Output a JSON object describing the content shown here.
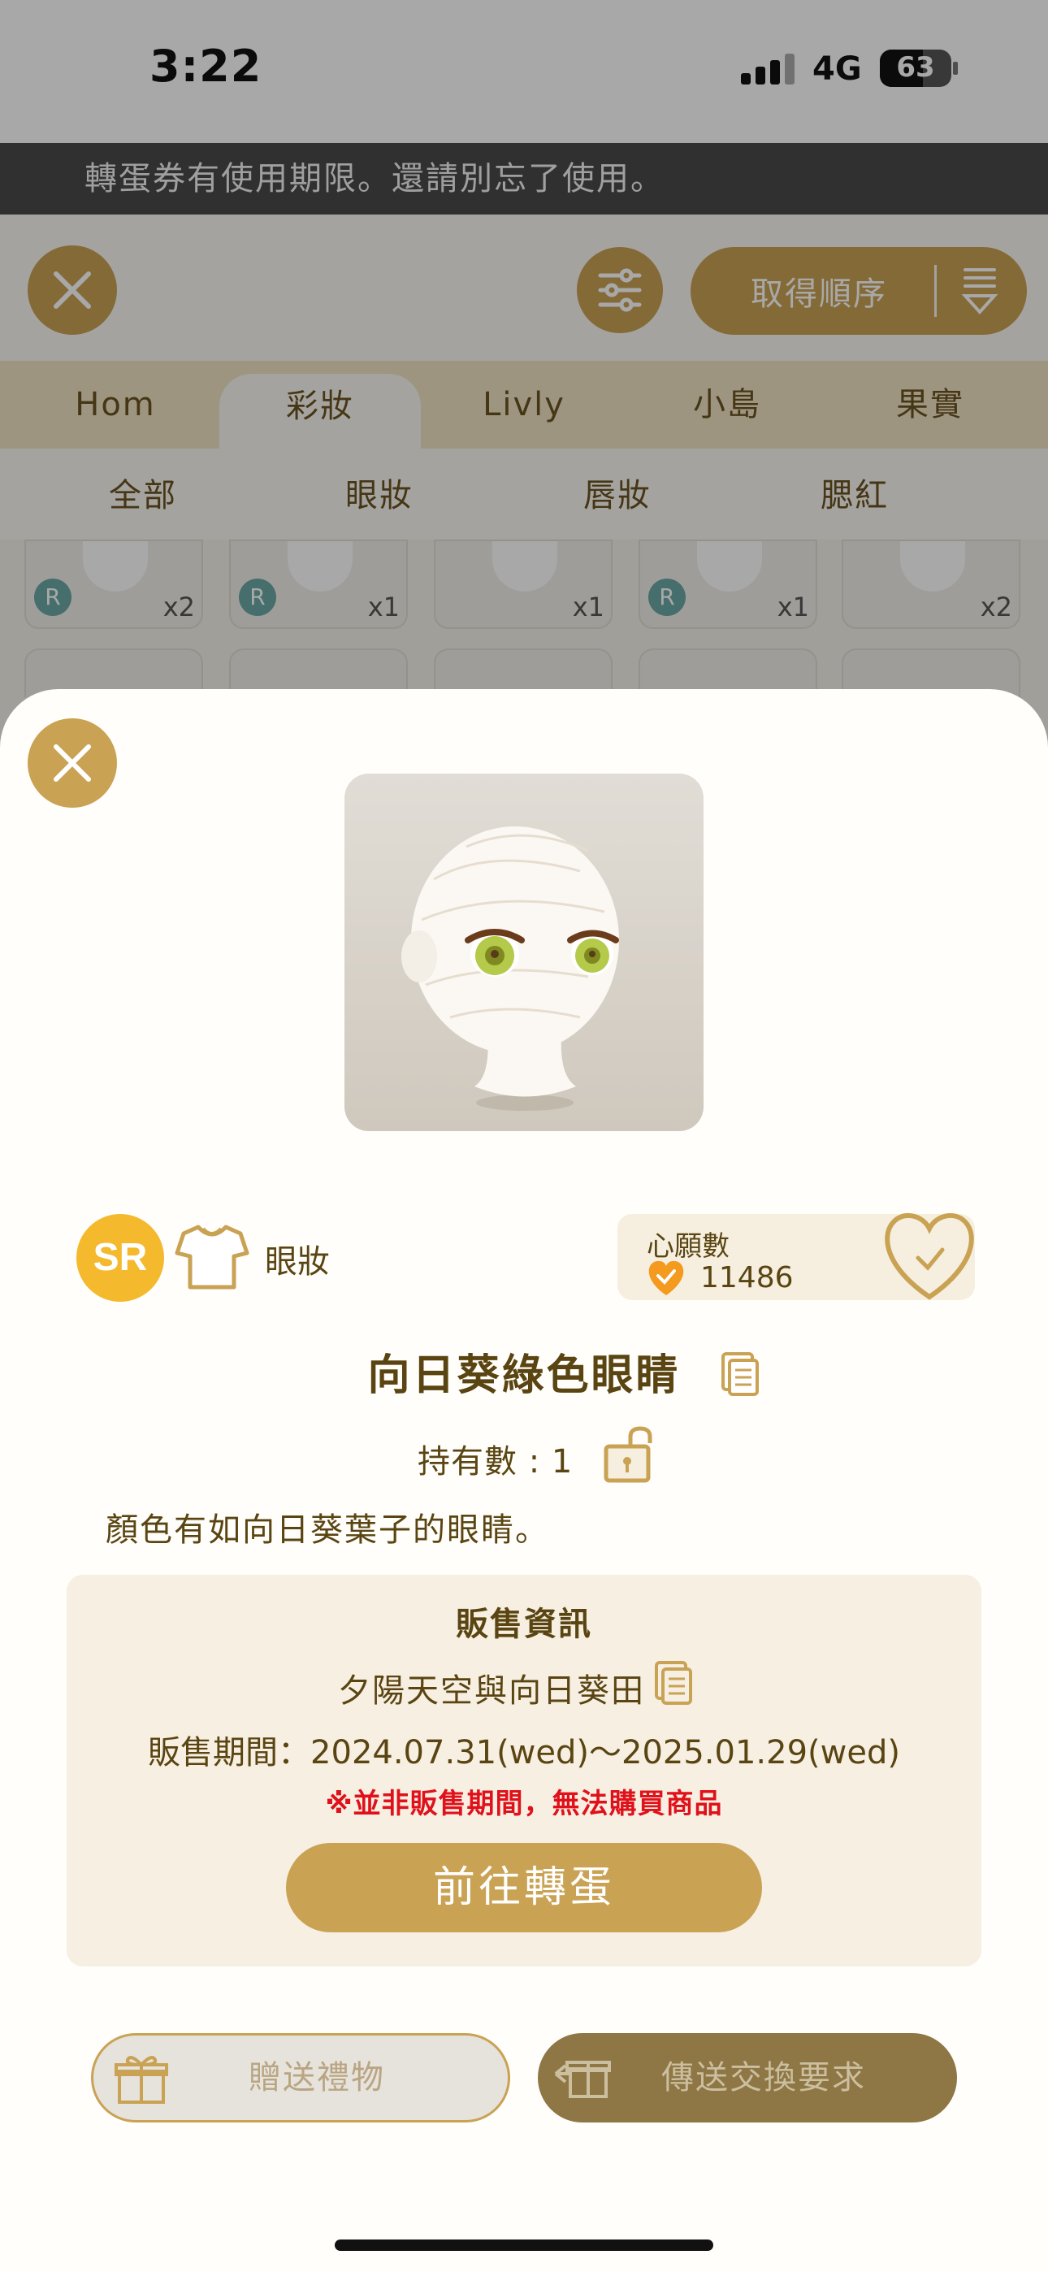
{
  "status_bar": {
    "time": "3:22",
    "network": "4G",
    "battery": "63"
  },
  "notice": "轉蛋券有使用期限。還請別忘了使用。",
  "toolbar": {
    "sort_label": "取得順序"
  },
  "category_tabs": [
    {
      "label": "Hom",
      "active": false
    },
    {
      "label": "彩妝",
      "active": true
    },
    {
      "label": "Livly",
      "active": false
    },
    {
      "label": "小島",
      "active": false
    },
    {
      "label": "果實",
      "active": false
    }
  ],
  "sub_tabs": [
    {
      "label": "全部",
      "active": false
    },
    {
      "label": "眼妝",
      "active": true
    },
    {
      "label": "唇妝",
      "active": false
    },
    {
      "label": "腮紅",
      "active": false
    }
  ],
  "grid_items": [
    {
      "rarity": "R",
      "qty": "x2"
    },
    {
      "rarity": "R",
      "qty": "x1"
    },
    {
      "rarity": "",
      "qty": "x1"
    },
    {
      "rarity": "R",
      "qty": "x1"
    },
    {
      "rarity": "",
      "qty": "x2"
    }
  ],
  "detail": {
    "rarity": "SR",
    "category": "眼妝",
    "wish_label": "心願數",
    "wish_count": "11486",
    "name": "向日葵綠色眼睛",
    "owned": "持有數 : 1",
    "description": "顏色有如向日葵葉子的眼睛。",
    "sale": {
      "title": "販售資訊",
      "source": "夕陽天空與向日葵田",
      "period": "販售期間：2024.07.31(wed)～2025.01.29(wed)",
      "warning": "※並非販售期間，無法購買商品",
      "gacha_button": "前往轉蛋"
    },
    "gift_button": "贈送禮物",
    "trade_button": "傳送交換要求"
  },
  "colors": {
    "gold": "#c9a254",
    "sr_badge": "#f4b92c",
    "warning": "#e0111b",
    "text_brown": "#5a4512"
  },
  "icons": [
    "close-icon",
    "filter-icon",
    "sort-icon",
    "shirt-icon",
    "heart-icon",
    "copy-icon",
    "unlock-icon",
    "gift-icon",
    "trade-icon"
  ]
}
